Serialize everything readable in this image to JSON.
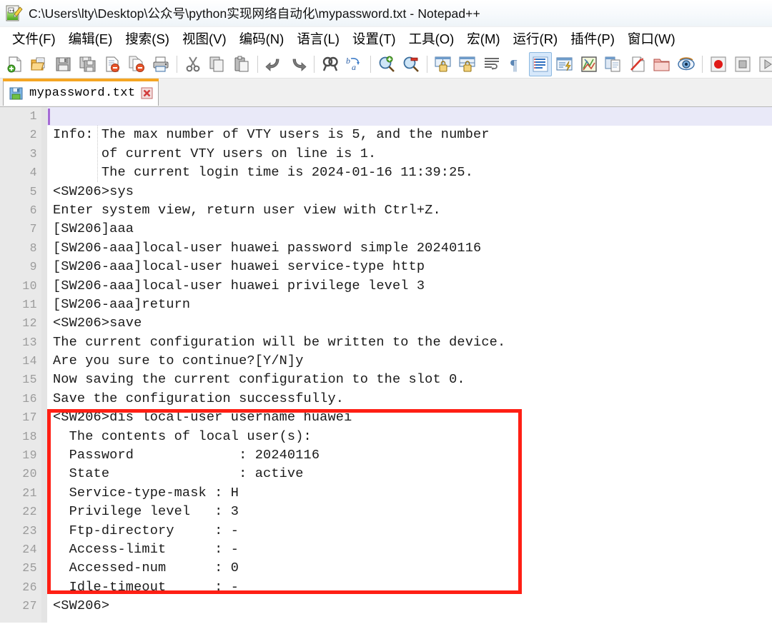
{
  "window": {
    "title": "C:\\Users\\lty\\Desktop\\公众号\\python实现网络自动化\\mypassword.txt - Notepad++",
    "app_icon": "notepad-plus-plus-icon"
  },
  "menu": {
    "items": [
      {
        "label": "文件(F)",
        "name": "menu-file"
      },
      {
        "label": "编辑(E)",
        "name": "menu-edit"
      },
      {
        "label": "搜索(S)",
        "name": "menu-search"
      },
      {
        "label": "视图(V)",
        "name": "menu-view"
      },
      {
        "label": "编码(N)",
        "name": "menu-encoding"
      },
      {
        "label": "语言(L)",
        "name": "menu-language"
      },
      {
        "label": "设置(T)",
        "name": "menu-settings"
      },
      {
        "label": "工具(O)",
        "name": "menu-tools"
      },
      {
        "label": "宏(M)",
        "name": "menu-macro"
      },
      {
        "label": "运行(R)",
        "name": "menu-run"
      },
      {
        "label": "插件(P)",
        "name": "menu-plugins"
      },
      {
        "label": "窗口(W)",
        "name": "menu-window"
      }
    ]
  },
  "toolbar": {
    "buttons": [
      "new-file-icon",
      "open-file-icon",
      "save-icon",
      "save-all-icon",
      "close-file-icon",
      "close-all-files-icon",
      "print-icon",
      "separator",
      "cut-icon",
      "copy-icon",
      "paste-icon",
      "separator",
      "undo-icon",
      "redo-icon",
      "separator",
      "find-icon",
      "replace-icon",
      "separator",
      "zoom-in-icon",
      "zoom-out-icon",
      "separator",
      "sync-vertical-scrolling-icon",
      "sync-horizontal-scrolling-icon",
      "word-wrap-icon",
      "show-all-characters-icon",
      "indent-guideline-icon",
      "user-defined-dialog-icon",
      "document-map-icon",
      "document-list-icon",
      "function-list-icon",
      "folder-as-workspace-icon",
      "monitoring-icon",
      "separator",
      "record-macro-icon",
      "stop-recording-icon",
      "play-macro-icon",
      "run-macro-multiple-times-icon"
    ],
    "active_button": "indent-guideline-icon"
  },
  "tabs": [
    {
      "label": "mypassword.txt",
      "save_state_icon": "saved-floppy-icon",
      "close_icon": "tab-close-icon",
      "active": true
    }
  ],
  "editor": {
    "current_line": 1,
    "total_lines": 27,
    "lines": [
      {
        "n": "1",
        "text": ""
      },
      {
        "n": "2",
        "text": "Info: The max number of VTY users is 5, and the number"
      },
      {
        "n": "3",
        "text": "      of current VTY users on line is 1."
      },
      {
        "n": "4",
        "text": "      The current login time is 2024-01-16 11:39:25."
      },
      {
        "n": "5",
        "text": "<SW206>sys"
      },
      {
        "n": "6",
        "text": "Enter system view, return user view with Ctrl+Z."
      },
      {
        "n": "7",
        "text": "[SW206]aaa"
      },
      {
        "n": "8",
        "text": "[SW206-aaa]local-user huawei password simple 20240116"
      },
      {
        "n": "9",
        "text": "[SW206-aaa]local-user huawei service-type http"
      },
      {
        "n": "10",
        "text": "[SW206-aaa]local-user huawei privilege level 3"
      },
      {
        "n": "11",
        "text": "[SW206-aaa]return"
      },
      {
        "n": "12",
        "text": "<SW206>save"
      },
      {
        "n": "13",
        "text": "The current configuration will be written to the device."
      },
      {
        "n": "14",
        "text": "Are you sure to continue?[Y/N]y"
      },
      {
        "n": "15",
        "text": "Now saving the current configuration to the slot 0."
      },
      {
        "n": "16",
        "text": "Save the configuration successfully."
      },
      {
        "n": "17",
        "text": "<SW206>dis local-user username huawei"
      },
      {
        "n": "18",
        "text": "  The contents of local user(s):"
      },
      {
        "n": "19",
        "text": "  Password             : 20240116"
      },
      {
        "n": "20",
        "text": "  State                : active"
      },
      {
        "n": "21",
        "text": "  Service-type-mask : H"
      },
      {
        "n": "22",
        "text": "  Privilege level   : 3"
      },
      {
        "n": "23",
        "text": "  Ftp-directory     : -"
      },
      {
        "n": "24",
        "text": "  Access-limit      : -"
      },
      {
        "n": "25",
        "text": "  Accessed-num      : 0"
      },
      {
        "n": "26",
        "text": "  Idle-timeout      : -"
      },
      {
        "n": "27",
        "text": "<SW206>"
      }
    ]
  },
  "annotation": {
    "type": "red-rectangle-highlight",
    "color": "#ff1f14",
    "covers_lines": "17-26"
  },
  "colors": {
    "accent_tab": "#f5a623",
    "gutter_bg": "#e9e9e9",
    "gutter_text": "#9b9b9b",
    "current_line_bg": "#e9e9f8",
    "caret": "#a66bd4",
    "text": "#1a1a1a",
    "annotation": "#ff1f14"
  }
}
